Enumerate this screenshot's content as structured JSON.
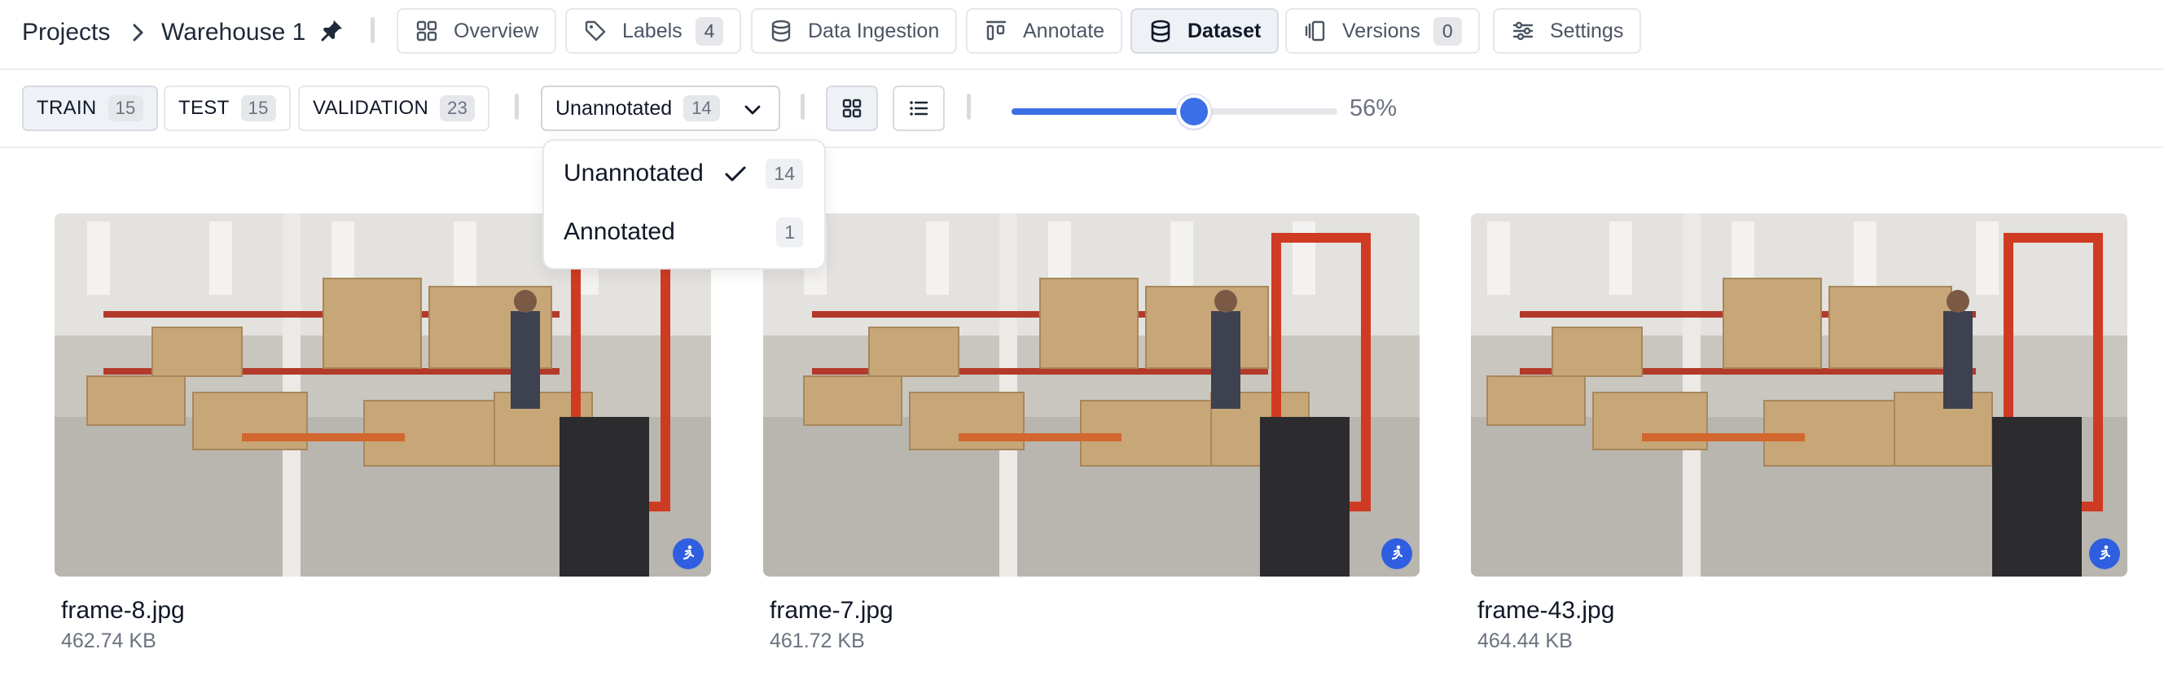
{
  "breadcrumb": {
    "root": "Projects",
    "project": "Warehouse 1"
  },
  "nav": {
    "tabs": [
      {
        "label": "Overview",
        "icon": "grid-icon"
      },
      {
        "label": "Labels",
        "icon": "tag-icon",
        "count": "4"
      },
      {
        "label": "Data Ingestion",
        "icon": "cylinder-icon"
      },
      {
        "label": "Annotate",
        "icon": "annotate-icon"
      },
      {
        "label": "Dataset",
        "icon": "database-icon",
        "active": true
      },
      {
        "label": "Versions",
        "icon": "versions-icon",
        "count": "0"
      },
      {
        "label": "Settings",
        "icon": "sliders-icon"
      }
    ]
  },
  "splits": [
    {
      "label": "TRAIN",
      "count": "15",
      "active": true
    },
    {
      "label": "TEST",
      "count": "15"
    },
    {
      "label": "VALIDATION",
      "count": "23"
    }
  ],
  "filter": {
    "selected_label": "Unannotated",
    "selected_count": "14",
    "options": [
      {
        "label": "Unannotated",
        "count": "14",
        "checked": true
      },
      {
        "label": "Annotated",
        "count": "1"
      }
    ]
  },
  "view_mode": {
    "active": "grid"
  },
  "zoom": {
    "value": 56,
    "label": "56%"
  },
  "images": [
    {
      "name": "frame-8.jpg",
      "size": "462.74 KB"
    },
    {
      "name": "frame-7.jpg",
      "size": "461.72 KB"
    },
    {
      "name": "frame-43.jpg",
      "size": "464.44 KB"
    }
  ],
  "colors": {
    "accent": "#3b6fe8",
    "badge": "#2f5fe0"
  }
}
